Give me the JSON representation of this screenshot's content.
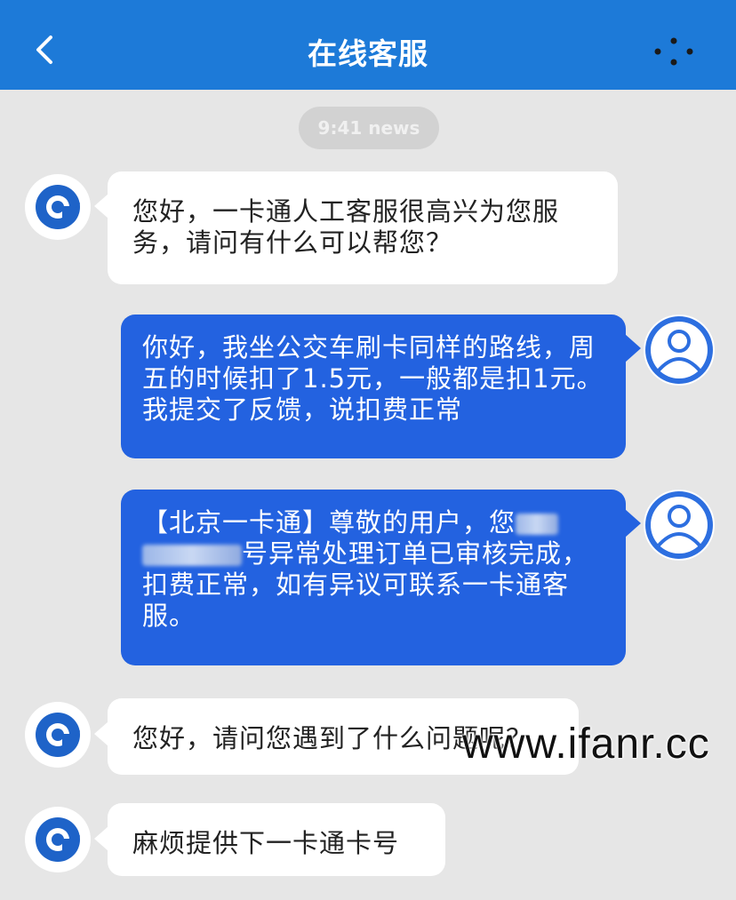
{
  "header": {
    "title": "在线客服",
    "back_icon": "chevron-left-icon",
    "more_icon": "more-dots-icon",
    "background": "#1d7ad8"
  },
  "timestamp": "9:41 news",
  "messages": [
    {
      "sender": "agent",
      "text": "您好，一卡通人工客服很高兴为您服务，请问有什么可以帮您？"
    },
    {
      "sender": "user",
      "text": "你好，我坐公交车刷卡同样的路线，周五的时候扣了1.5元，一般都是扣1元。我提交了反馈，说扣费正常"
    },
    {
      "sender": "user",
      "text_a": "【北京一卡通】尊敬的用户，您",
      "text_b": "号异常处理订单已审核完成，扣费正常，如有异议可联系一卡通客服。"
    },
    {
      "sender": "agent",
      "text": "您好，请问您遇到了什么问题呢？"
    },
    {
      "sender": "agent",
      "text": "麻烦提供下一卡通卡号"
    }
  ],
  "watermark": "www.ifanr.cc",
  "colors": {
    "agent_bubble": "#ffffff",
    "user_bubble": "#2362e0",
    "chat_background": "#e6e6e6"
  }
}
